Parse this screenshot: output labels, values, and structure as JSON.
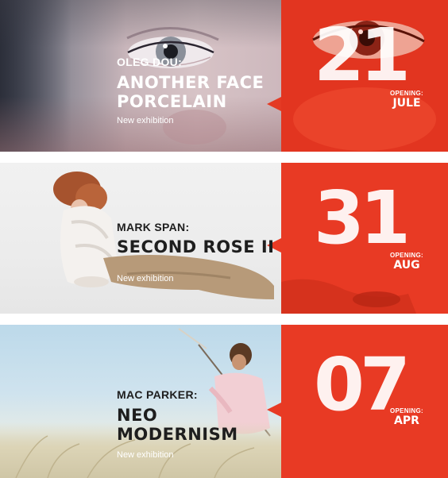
{
  "exhibitions": [
    {
      "artist": "OLEG DOU:",
      "title_line1": "ANOTHER FACE",
      "title_line2": "PORCELAIN",
      "subtitle": "New exhibition",
      "day": "21",
      "opening_label": "OPENING:",
      "month": "JULE"
    },
    {
      "artist": "MARK SPAN:",
      "title_line1": "SECOND ROSE II",
      "title_line2": "",
      "subtitle": "New exhibition",
      "day": "31",
      "opening_label": "OPENING:",
      "month": "AUG"
    },
    {
      "artist": "MAC PARKER:",
      "title_line1": "NEO",
      "title_line2": "MODERNISM",
      "subtitle": "New exhibition",
      "day": "07",
      "opening_label": "OPENING:",
      "month": "APR"
    }
  ],
  "colors": {
    "accent_red": "#e83a24",
    "text_dark": "#1e1e1e",
    "text_light": "#ffffff"
  }
}
